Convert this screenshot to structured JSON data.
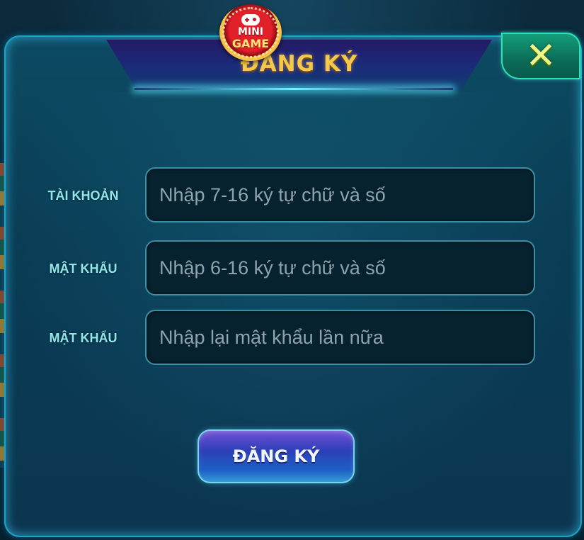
{
  "dialog": {
    "title": "ĐĂNG KÝ",
    "logo": {
      "line1": "MINI",
      "line2": "GAME",
      "icon": "gamepad-icon"
    },
    "close_icon": "close-icon",
    "close_glyph": "✕"
  },
  "form": {
    "fields": [
      {
        "label": "TÀI KHOẢN",
        "placeholder": "Nhập 7-16 ký tự chữ và số",
        "value": ""
      },
      {
        "label": "MẬT KHẨU",
        "placeholder": "Nhập 6-16 ký tự chữ và số",
        "value": ""
      },
      {
        "label": "MẬT KHẨU",
        "placeholder": "Nhập lại mật khẩu lần nữa",
        "value": ""
      }
    ],
    "submit_label": "ĐĂNG KÝ"
  },
  "colors": {
    "title": "#f3c84d",
    "label": "#8fe7e9",
    "panel": "#0d4a63",
    "close_button": "#14a07a",
    "submit_button": "#2d3fb8"
  }
}
